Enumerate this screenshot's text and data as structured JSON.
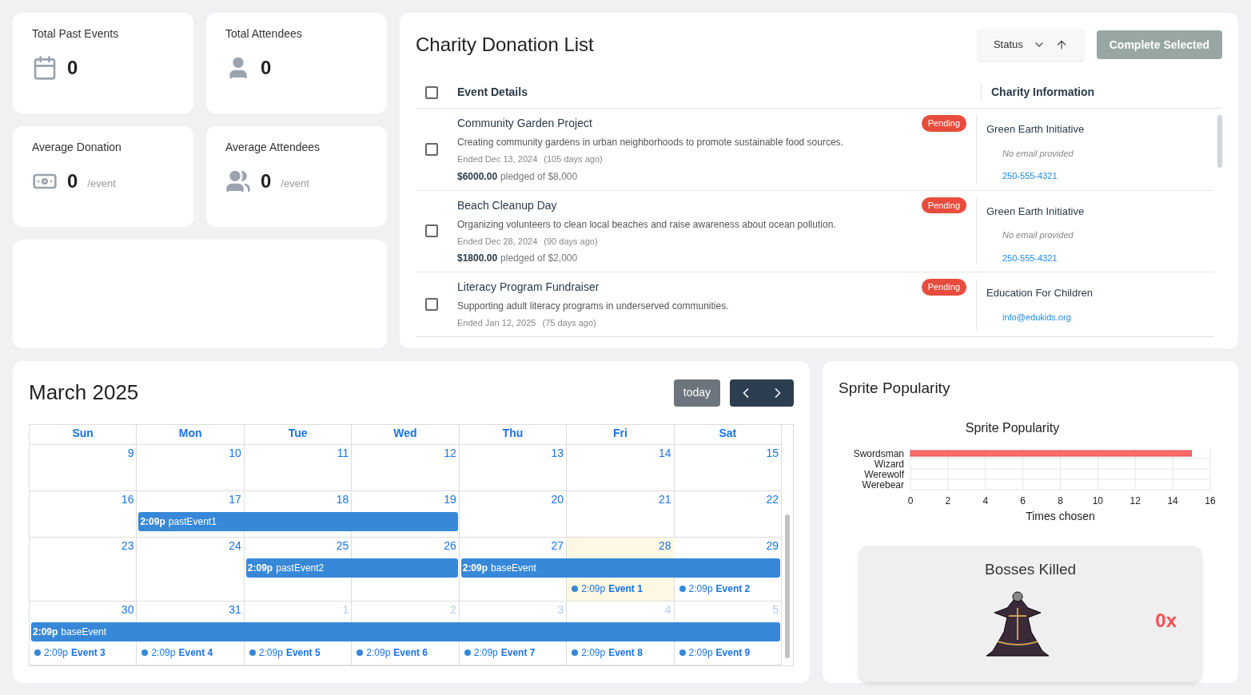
{
  "stats": [
    {
      "label": "Total Past Events",
      "value": "0"
    },
    {
      "label": "Total Attendees",
      "value": "0"
    },
    {
      "label": "Average Donation",
      "value": "0",
      "suffix": "/event"
    },
    {
      "label": "Average Attendees",
      "value": "0",
      "suffix": "/event"
    }
  ],
  "donations": {
    "title": "Charity Donation List",
    "sort_field": "Status",
    "complete_button": {
      "label": "Complete Selected",
      "disabled": true
    },
    "select_all_checked": false,
    "columns": [
      "Event Details",
      "Charity Information"
    ],
    "rows": [
      {
        "checked": false,
        "title": "Community Garden Project",
        "status": "Pending",
        "description": "Creating community gardens in urban neighborhoods to promote sustainable food sources.",
        "ended": "Ended Dec 13, 2024",
        "ago": "(105 days ago)",
        "amount": "$6000.00",
        "pledged": "pledged of $8,000",
        "charity": "Green Earth Initiative",
        "email": {
          "kind": "missing",
          "text": "No email provided"
        },
        "phone": "250-555-4321"
      },
      {
        "checked": false,
        "title": "Beach Cleanup Day",
        "status": "Pending",
        "description": "Organizing volunteers to clean local beaches and raise awareness about ocean pollution.",
        "ended": "Ended Dec 28, 2024",
        "ago": "(90 days ago)",
        "amount": "$1800.00",
        "pledged": "pledged of $2,000",
        "charity": "Green Earth Initiative",
        "email": {
          "kind": "missing",
          "text": "No email provided"
        },
        "phone": "250-555-4321"
      },
      {
        "checked": false,
        "title": "Literacy Program Fundraiser",
        "status": "Pending",
        "description": "Supporting adult literacy programs in underserved communities.",
        "ended": "Ended Jan 12, 2025",
        "ago": "(75 days ago)",
        "charity": "Education For Children",
        "email": {
          "kind": "link",
          "text": "info@edukids.org"
        }
      }
    ]
  },
  "calendar": {
    "title": "March 2025",
    "today_button": "today",
    "weekdays": [
      "Sun",
      "Mon",
      "Tue",
      "Wed",
      "Thu",
      "Fri",
      "Sat"
    ],
    "weeks": [
      {
        "days": [
          {
            "num": "9",
            "other_month": false,
            "today": false
          },
          {
            "num": "10",
            "other_month": false,
            "today": false
          },
          {
            "num": "11",
            "other_month": false,
            "today": false
          },
          {
            "num": "12",
            "other_month": false,
            "today": false
          },
          {
            "num": "13",
            "other_month": false,
            "today": false
          },
          {
            "num": "14",
            "other_month": false,
            "today": false
          },
          {
            "num": "15",
            "other_month": false,
            "today": false
          }
        ]
      },
      {
        "days": [
          {
            "num": "16",
            "other_month": false,
            "today": false
          },
          {
            "num": "17",
            "other_month": false,
            "today": false
          },
          {
            "num": "18",
            "other_month": false,
            "today": false
          },
          {
            "num": "19",
            "other_month": false,
            "today": false
          },
          {
            "num": "20",
            "other_month": false,
            "today": false
          },
          {
            "num": "21",
            "other_month": false,
            "today": false
          },
          {
            "num": "22",
            "other_month": false,
            "today": false
          }
        ],
        "bars": [
          {
            "time": "2:09p",
            "title": "pastEvent1"
          }
        ]
      },
      {
        "days": [
          {
            "num": "23",
            "other_month": false,
            "today": false
          },
          {
            "num": "24",
            "other_month": false,
            "today": false
          },
          {
            "num": "25",
            "other_month": false,
            "today": false
          },
          {
            "num": "26",
            "other_month": false,
            "today": false
          },
          {
            "num": "27",
            "other_month": false,
            "today": false
          },
          {
            "num": "28",
            "other_month": false,
            "today": true,
            "events": [
              {
                "time": "2:09p",
                "title": "Event 1"
              }
            ]
          },
          {
            "num": "29",
            "other_month": false,
            "today": false,
            "events": [
              {
                "time": "2:09p",
                "title": "Event 2"
              }
            ]
          }
        ],
        "bars": [
          {
            "time": "2:09p",
            "title": "pastEvent2"
          },
          {
            "time": "2:09p",
            "title": "baseEvent"
          }
        ]
      },
      {
        "days": [
          {
            "num": "30",
            "other_month": false,
            "today": false,
            "events": [
              {
                "time": "2:09p",
                "title": "Event 3"
              }
            ]
          },
          {
            "num": "31",
            "other_month": false,
            "today": false,
            "events": [
              {
                "time": "2:09p",
                "title": "Event 4"
              }
            ]
          },
          {
            "num": "1",
            "other_month": true,
            "today": false,
            "events": [
              {
                "time": "2:09p",
                "title": "Event 5"
              }
            ]
          },
          {
            "num": "2",
            "other_month": true,
            "today": false,
            "events": [
              {
                "time": "2:09p",
                "title": "Event 6"
              }
            ]
          },
          {
            "num": "3",
            "other_month": true,
            "today": false,
            "events": [
              {
                "time": "2:09p",
                "title": "Event 7"
              }
            ]
          },
          {
            "num": "4",
            "other_month": true,
            "today": false,
            "events": [
              {
                "time": "2:09p",
                "title": "Event 8"
              }
            ]
          },
          {
            "num": "5",
            "other_month": true,
            "today": false,
            "events": [
              {
                "time": "2:09p",
                "title": "Event 9"
              }
            ]
          }
        ],
        "bars": [
          {
            "time": "2:09p",
            "title": "baseEvent"
          }
        ]
      }
    ]
  },
  "sprites": {
    "title": "Sprite Popularity",
    "chart_data": {
      "type": "bar",
      "orientation": "horizontal",
      "title": "Sprite Popularity",
      "xlabel": "Times chosen",
      "categories": [
        "Swordsman",
        "Wizard",
        "Werewolf",
        "Werebear"
      ],
      "series": [
        {
          "color": "#ff6b6b",
          "values": [
            15,
            0,
            0,
            0
          ]
        }
      ],
      "xlim": [
        0,
        16
      ],
      "xticks": [
        0,
        2,
        4,
        6,
        8,
        10,
        12,
        14,
        16
      ],
      "grid": true
    },
    "bosses": {
      "title": "Bosses Killed",
      "count": "0x"
    }
  }
}
